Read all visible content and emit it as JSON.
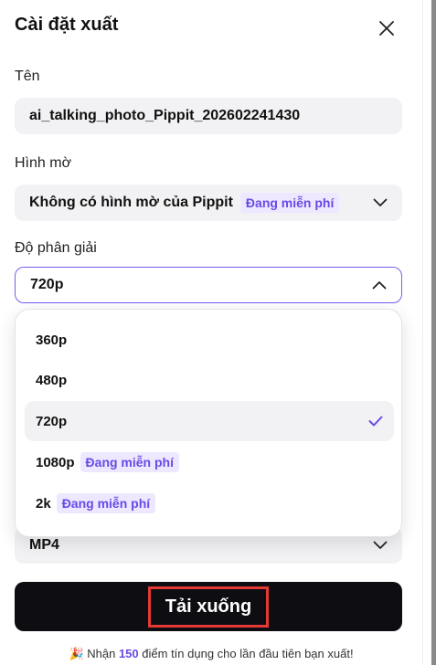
{
  "dialog": {
    "title": "Cài đặt xuất"
  },
  "name_section": {
    "label": "Tên",
    "value": "ai_talking_photo_Pippit_202602241430"
  },
  "watermark_section": {
    "label": "Hình mờ",
    "value": "Không có hình mờ của Pippit",
    "badge": "Đang miễn phí"
  },
  "resolution_section": {
    "label": "Độ phân giải",
    "value": "720p",
    "options": [
      {
        "label": "360p",
        "badge": ""
      },
      {
        "label": "480p",
        "badge": ""
      },
      {
        "label": "720p",
        "badge": "",
        "selected": true
      },
      {
        "label": "1080p",
        "badge": "Đang miễn phí"
      },
      {
        "label": "2k",
        "badge": "Đang miễn phí"
      }
    ]
  },
  "format_section": {
    "value": "MP4"
  },
  "download_button": {
    "label": "Tải xuống"
  },
  "promo": {
    "prefix": "Nhận",
    "credits": "150",
    "suffix": "điểm tín dụng cho lần đầu tiên bạn xuất!"
  },
  "colors": {
    "accent": "#7b5cf0",
    "badge_bg": "#ede8ff",
    "badge_text": "#6a49e6",
    "button_bg": "#0d0d12",
    "highlight_border": "#e53935"
  }
}
